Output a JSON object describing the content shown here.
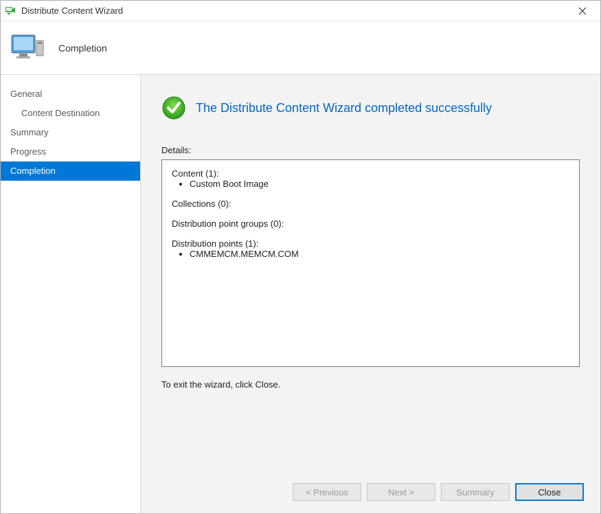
{
  "titlebar": {
    "title": "Distribute Content Wizard"
  },
  "header": {
    "title": "Completion"
  },
  "sidebar": {
    "items": [
      {
        "label": "General",
        "indent": false,
        "active": false
      },
      {
        "label": "Content Destination",
        "indent": true,
        "active": false
      },
      {
        "label": "Summary",
        "indent": false,
        "active": false
      },
      {
        "label": "Progress",
        "indent": false,
        "active": false
      },
      {
        "label": "Completion",
        "indent": false,
        "active": true
      }
    ]
  },
  "main": {
    "success_message": "The Distribute Content Wizard completed successfully",
    "details_label": "Details:",
    "details": {
      "sections": [
        {
          "title": "Content (1):",
          "items": [
            "Custom Boot Image"
          ]
        },
        {
          "title": "Collections (0):",
          "items": []
        },
        {
          "title": "Distribution point groups (0):",
          "items": []
        },
        {
          "title": "Distribution points (1):",
          "items": [
            "CMMEMCM.MEMCM.COM"
          ]
        }
      ]
    },
    "exit_text": "To exit the wizard, click Close."
  },
  "buttons": {
    "previous": "< Previous",
    "next": "Next >",
    "summary": "Summary",
    "close": "Close"
  }
}
